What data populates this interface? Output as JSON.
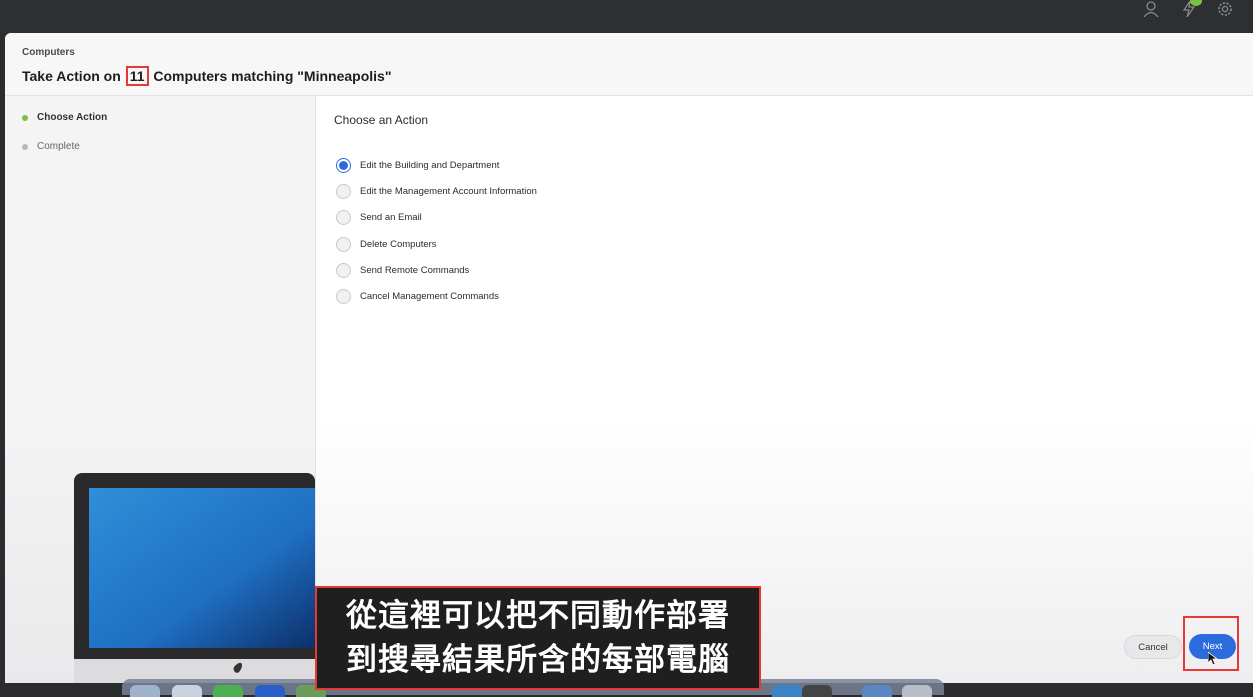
{
  "header": {
    "breadcrumb": "Computers",
    "title_prefix": "Take Action on",
    "title_count": "11",
    "title_suffix": "Computers matching \"Minneapolis\""
  },
  "steps": [
    {
      "label": "Choose Action",
      "active": true
    },
    {
      "label": "Complete",
      "active": false
    }
  ],
  "main": {
    "heading": "Choose an Action",
    "options": [
      {
        "label": "Edit the Building and Department",
        "selected": true
      },
      {
        "label": "Edit the Management Account Information",
        "selected": false
      },
      {
        "label": "Send an Email",
        "selected": false
      },
      {
        "label": "Delete Computers",
        "selected": false
      },
      {
        "label": "Send Remote Commands",
        "selected": false
      },
      {
        "label": "Cancel Management Commands",
        "selected": false
      }
    ]
  },
  "buttons": {
    "cancel": "Cancel",
    "next": "Next"
  },
  "subtitle": {
    "line1": "從這裡可以把不同動作部署",
    "line2": "到搜尋結果所含的每部電腦"
  },
  "topbar_icons": [
    "user-icon",
    "lightning-icon",
    "gear-icon"
  ],
  "colors": {
    "accent": "#2c6bde",
    "active_step": "#7ac142",
    "highlight": "#e53935"
  }
}
